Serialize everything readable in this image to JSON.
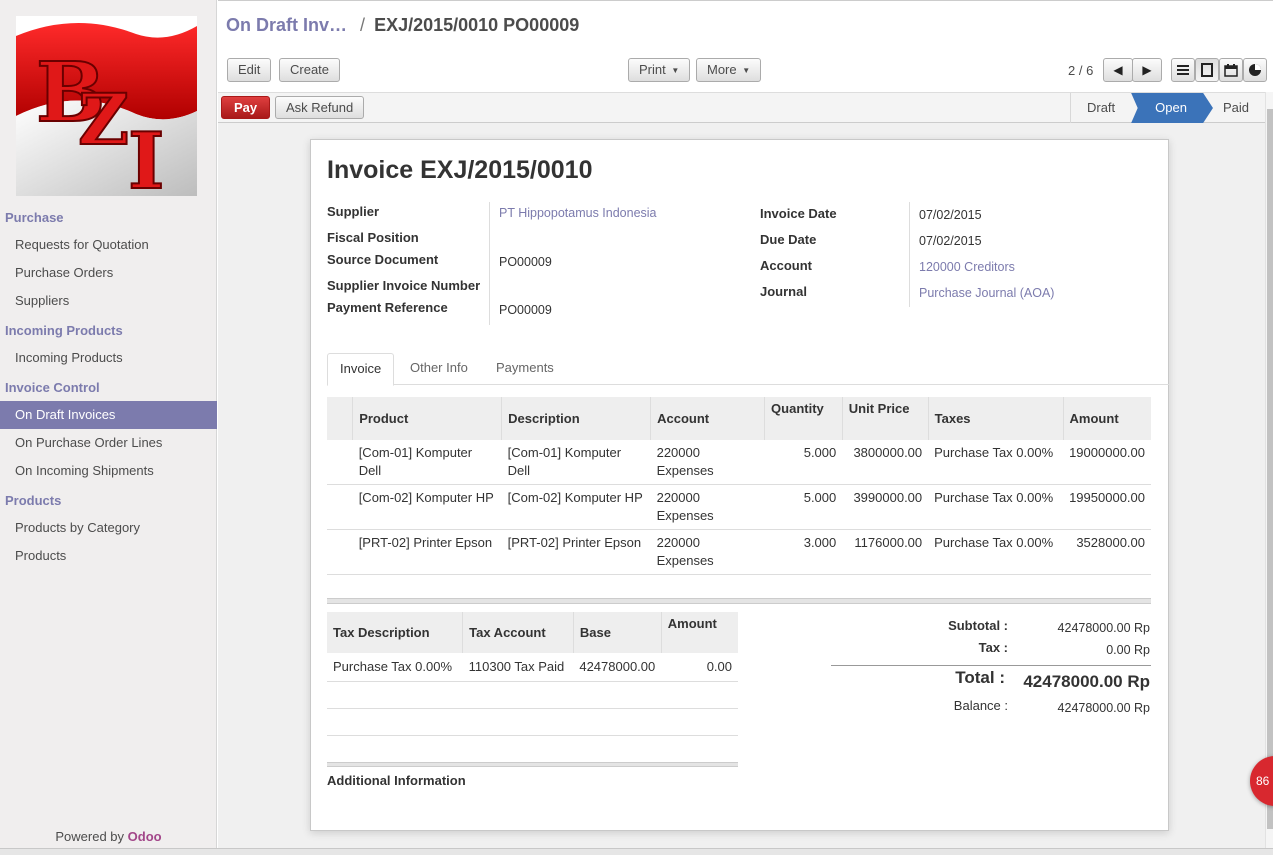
{
  "sidebar": {
    "logo_text": "BZI",
    "sections": [
      {
        "title": "Purchase",
        "items": [
          "Requests for Quotation",
          "Purchase Orders",
          "Suppliers"
        ]
      },
      {
        "title": "Incoming Products",
        "items": [
          "Incoming Products"
        ]
      },
      {
        "title": "Invoice Control",
        "items": [
          "On Draft Invoices",
          "On Purchase Order Lines",
          "On Incoming Shipments"
        ]
      },
      {
        "title": "Products",
        "items": [
          "Products by Category",
          "Products"
        ]
      }
    ],
    "active_item": "On Draft Invoices",
    "powered_by": "Powered by",
    "powered_brand": "Odoo"
  },
  "header": {
    "breadcrumb_parent": "On Draft Inv…",
    "breadcrumb_sep": "/",
    "breadcrumb_current": "EXJ/2015/0010 PO00009",
    "buttons": {
      "edit": "Edit",
      "create": "Create",
      "print": "Print",
      "more": "More"
    },
    "pager": "2 / 6"
  },
  "statusbar": {
    "pay": "Pay",
    "ask_refund": "Ask Refund",
    "steps": [
      "Draft",
      "Open",
      "Paid"
    ],
    "active_step": "Open"
  },
  "form": {
    "title": "Invoice EXJ/2015/0010",
    "left_fields": [
      {
        "label": "Supplier",
        "value": "PT Hippopotamus Indonesia"
      },
      {
        "label": "Fiscal Position",
        "value": ""
      },
      {
        "label": "Source Document",
        "value": "PO00009"
      },
      {
        "label": "Supplier Invoice Number",
        "value": ""
      },
      {
        "label": "Payment Reference",
        "value": "PO00009"
      }
    ],
    "right_fields": [
      {
        "label": "Invoice Date",
        "value": "07/02/2015"
      },
      {
        "label": "Due Date",
        "value": "07/02/2015"
      },
      {
        "label": "Account",
        "value": "120000 Creditors"
      },
      {
        "label": "Journal",
        "value": "Purchase Journal (AOA)"
      }
    ],
    "tabs": [
      "Invoice",
      "Other Info",
      "Payments"
    ],
    "active_tab": "Invoice",
    "lines": {
      "headers": [
        "Product",
        "Description",
        "Account",
        "Quantity",
        "Unit Price",
        "Taxes",
        "Amount"
      ],
      "rows": [
        {
          "product": "[Com-01] Komputer Dell",
          "description": "[Com-01] Komputer Dell",
          "account": "220000 Expenses",
          "quantity": "5.000",
          "unit_price": "3800000.00",
          "taxes": "Purchase Tax 0.00%",
          "amount": "19000000.00"
        },
        {
          "product": "[Com-02] Komputer HP",
          "description": "[Com-02] Komputer HP",
          "account": "220000 Expenses",
          "quantity": "5.000",
          "unit_price": "3990000.00",
          "taxes": "Purchase Tax 0.00%",
          "amount": "19950000.00"
        },
        {
          "product": "[PRT-02] Printer Epson",
          "description": "[PRT-02] Printer Epson",
          "account": "220000 Expenses",
          "quantity": "3.000",
          "unit_price": "1176000.00",
          "taxes": "Purchase Tax 0.00%",
          "amount": "3528000.00"
        }
      ]
    },
    "tax_lines": {
      "headers": [
        "Tax Description",
        "Tax Account",
        "Base",
        "Amount"
      ],
      "rows": [
        {
          "description": "Purchase Tax 0.00%",
          "account": "110300 Tax Paid",
          "base": "42478000.00",
          "amount": "0.00"
        }
      ]
    },
    "totals": {
      "subtotal_label": "Subtotal :",
      "subtotal": "42478000.00 Rp",
      "tax_label": "Tax :",
      "tax": "0.00 Rp",
      "total_label": "Total :",
      "total": "42478000.00 Rp",
      "balance_label": "Balance :",
      "balance": "42478000.00 Rp"
    },
    "additional_info": "Additional Information"
  },
  "chat_badge": "86",
  "colors": {
    "accent": "#7c7bad",
    "pay": "#c02626",
    "status_active": "#3b73b9",
    "brand": "#a24689"
  }
}
